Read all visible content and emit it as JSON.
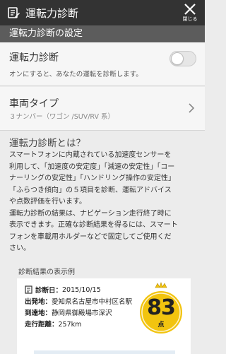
{
  "titlebar": {
    "title": "運転力診断",
    "close_label": "閉じる",
    "app_icon": "edit-note-icon",
    "close_icon": "close-x-icon"
  },
  "section_header": "運転力診断の設定",
  "settings": {
    "diagnosis": {
      "label": "運転力診断",
      "description": "オンにすると、あなたの運転を診断します。",
      "enabled": false
    },
    "vehicle": {
      "label": "車両タイプ",
      "value": "３ナンバー（ワゴン /SUV/RV 系）"
    }
  },
  "about": {
    "heading": "運転力診断とは？",
    "lines": [
      "スマートフォンに内蔵されている加速度センサーを",
      "利用して、「加速度の安定度」「減速の安定性」「コー",
      "ナーリングの安定性」「ハンドリング操作の安定性」",
      "「ふらつき傾向」の５項目を診断、運転アドバイス",
      "や点数評価を行います。",
      "運転力診断の結果は、ナビゲーション走行終了時に",
      "表示できます。正確な診断結果を得るには、スマート",
      "フォンを車載用ホルダーなどで固定してご使用くだ",
      "さい。"
    ],
    "example_label": "診断結果の表示例"
  },
  "example": {
    "date_label": "診断日：",
    "date": "2015/10/15",
    "departure_label": "出発地：",
    "departure": "愛知県名古屋市中村区名駅",
    "arrival_label": "到達地：",
    "arrival": "静岡県御殿場市深沢",
    "distance_label": "走行距離：",
    "distance": "257km",
    "score": "83",
    "score_unit": "点",
    "badge_color": "#f2c40f"
  }
}
